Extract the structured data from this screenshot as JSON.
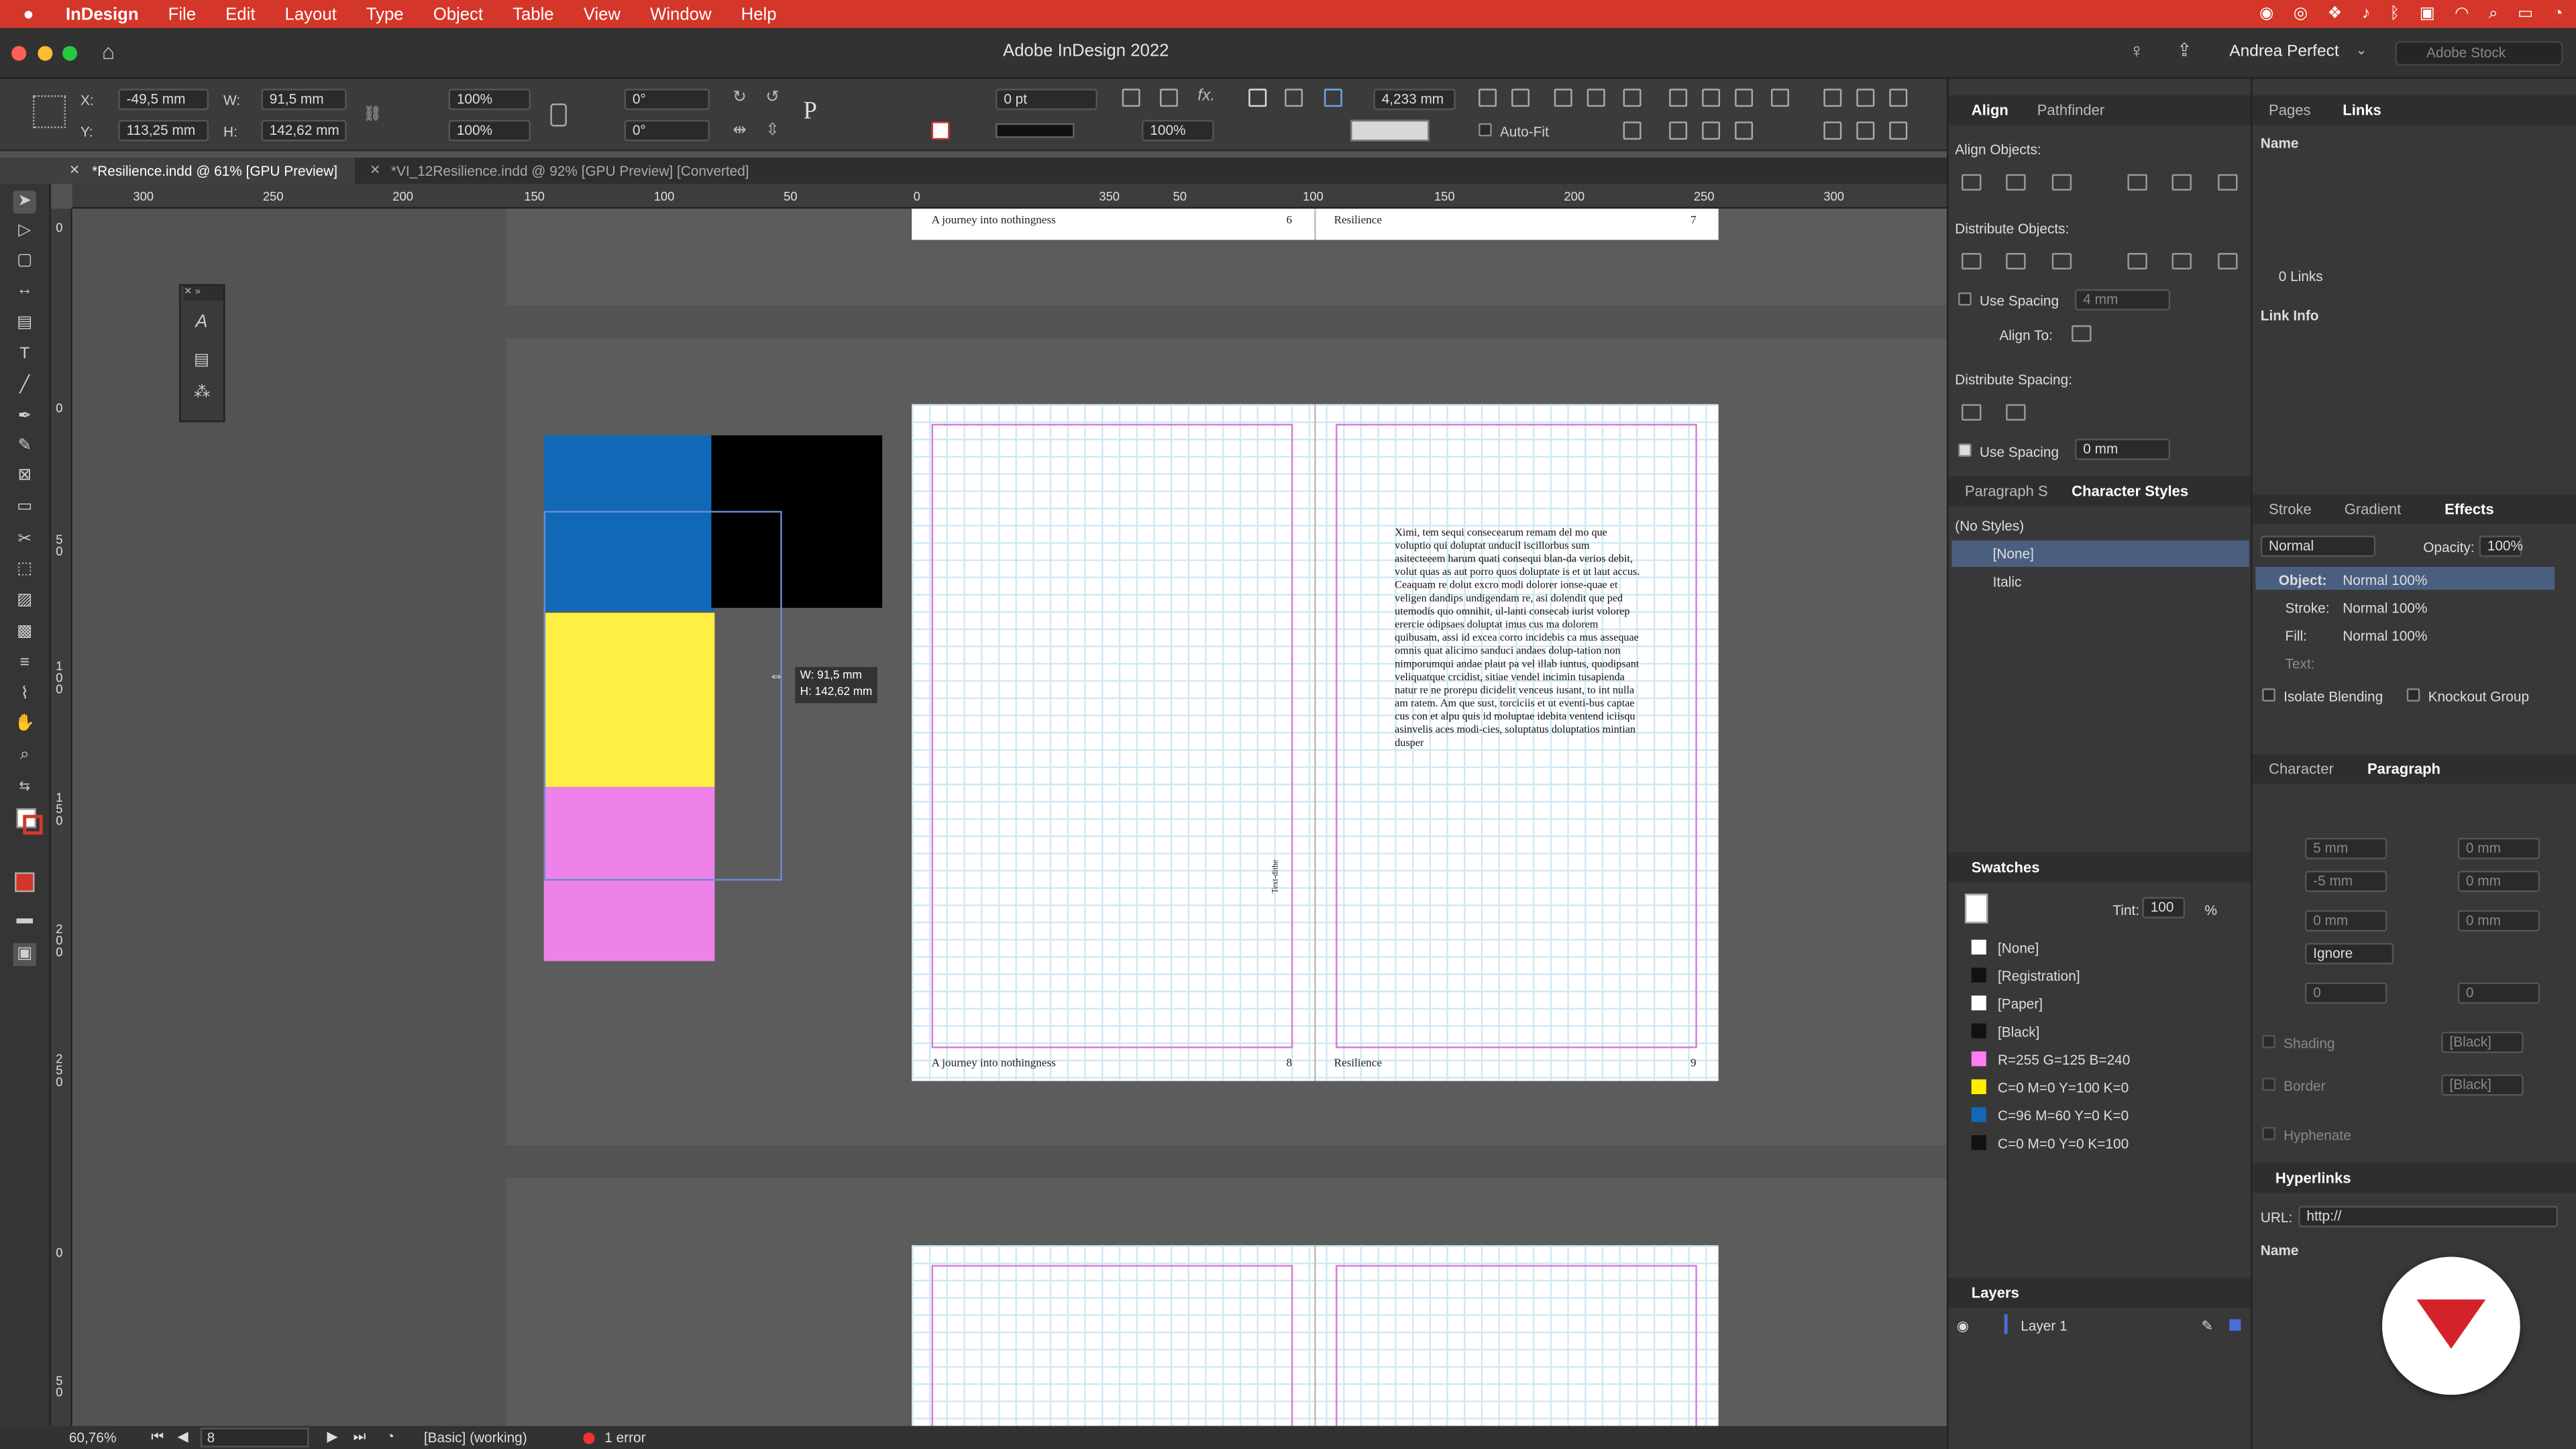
{
  "menubar": {
    "app": "InDesign",
    "items": [
      "File",
      "Edit",
      "Layout",
      "Type",
      "Object",
      "Table",
      "View",
      "Window",
      "Help"
    ]
  },
  "window": {
    "title": "Adobe InDesign 2022",
    "user": "Andrea Perfect",
    "stock_placeholder": "Adobe Stock"
  },
  "control": {
    "x": "-49,5 mm",
    "y": "113,25 mm",
    "w": "91,5 mm",
    "h": "142,62 mm",
    "scale_x": "100%",
    "scale_y": "100%",
    "angle": "0°",
    "shear": "0°",
    "stroke_weight": "0 pt",
    "opacity": "100%",
    "gap": "4,233 mm",
    "auto_fit": "Auto-Fit",
    "labels": {
      "x": "X:",
      "y": "Y:",
      "w": "W:",
      "h": "H:"
    }
  },
  "tabs": [
    {
      "label": "*Resilience.indd @ 61% [GPU Preview]"
    },
    {
      "label": "*VI_12Resilience.indd @ 92% [GPU Preview] [Converted]"
    }
  ],
  "ruler_h": [
    "300",
    "250",
    "200",
    "150",
    "100",
    "50",
    "0",
    "50",
    "100",
    "150",
    "200",
    "250",
    "300",
    "350"
  ],
  "ruler_v": [
    "0",
    "0",
    "5 0",
    "1 0 0",
    "1 5 0",
    "2 0 0",
    "2 5 0",
    "0",
    "5 0"
  ],
  "pages": {
    "top_left_footer": "A journey into nothingness",
    "top_left_num": "6",
    "top_right_footer": "Resilience",
    "top_right_num": "7",
    "left_footer": "A journey into nothingness",
    "left_num": "8",
    "right_footer": "Resilience",
    "right_num": "9",
    "spine": "Text-dithe"
  },
  "body_text": "Ximi, tem sequi consecearum remam del mo que voluptio qui doluptat unducil iscillorbus sum asitecteeem harum quati consequi blan-da verios debit, volut quas as aut porro quos doluptate is et ut laut accus. Ceaquam re dolut excro modi dolorer ionse-quae et veligen dandips undigendam re, asi dolendit que ped utemodis quo omnihit, ul-lanti consecab iurist volorep erercie odipsaes doluptat imus cus ma dolorem quibusam, assi id excea corro incidebis ca mus assequae omnis quat alicimo sanduci andaes dolup-tation non nimporumqui andae plaut pa vel illab iuntus, quodipsant veliquatque crcidist, sitiae vendel incimin tusapienda natur re ne prorepu dicidelit venceus iusant, to int nulla am ratem. Am que sust, torciciis et ut eventi-bus captae cus con et alpu quis id moluptae idebita ventend iciisqu asinvelis aces modi-cies, soluptatus doluptatios mintian dusper",
  "measure": {
    "w": "W: 91,5 mm",
    "h": "H: 142,62 mm"
  },
  "status": {
    "zoom": "60,76%",
    "page": "8",
    "style": "[Basic] (working)",
    "errors": "1 error"
  },
  "align_panel": {
    "tab1": "Align",
    "tab2": "Pathfinder",
    "align_objects": "Align Objects:",
    "distribute_objects": "Distribute Objects:",
    "use_spacing": "Use Spacing",
    "spacing_val": "4 mm",
    "align_to": "Align To:",
    "distribute_spacing": "Distribute Spacing:",
    "use_spacing2": "Use Spacing",
    "spacing_val2": "0 mm"
  },
  "char_styles": {
    "tab1": "Paragraph S",
    "tab2": "Character Styles",
    "no_styles": "(No Styles)",
    "items": [
      "[None]",
      "Italic"
    ]
  },
  "swatches": {
    "title": "Swatches",
    "tint_label": "Tint:",
    "tint": "100",
    "pct": "%",
    "items": [
      {
        "name": "[None]",
        "color": "#ffffff"
      },
      {
        "name": "[Registration]",
        "color": "#111111"
      },
      {
        "name": "[Paper]",
        "color": "#ffffff"
      },
      {
        "name": "[Black]",
        "color": "#111111"
      },
      {
        "name": "R=255 G=125 B=240",
        "color": "#ff7df0"
      },
      {
        "name": "C=0 M=0 Y=100 K=0",
        "color": "#ffee00"
      },
      {
        "name": "C=96 M=60 Y=0 K=0",
        "color": "#1168b7"
      },
      {
        "name": "C=0 M=0 Y=0 K=100",
        "color": "#111111"
      }
    ]
  },
  "layers": {
    "title": "Layers",
    "layer": "Layer 1"
  },
  "pages_panel": {
    "tab1": "Pages",
    "tab2": "Links",
    "name": "Name",
    "links_count": "0 Links",
    "link_info": "Link Info"
  },
  "effects": {
    "tab1": "Stroke",
    "tab2": "Gradient",
    "tab3": "Effects",
    "mode": "Normal",
    "opacity_label": "Opacity:",
    "opacity": "100%",
    "object": "Object:",
    "object_val": "Normal 100%",
    "stroke": "Stroke:",
    "stroke_val": "Normal 100%",
    "fill": "Fill:",
    "fill_val": "Normal 100%",
    "text": "Text:",
    "isolate": "Isolate Blending",
    "knockout": "Knockout Group"
  },
  "paragraph": {
    "tab1": "Character",
    "tab2": "Paragraph",
    "indent1": "5 mm",
    "indent2": "0 mm",
    "indent3": "-5 mm",
    "indent4": "0 mm",
    "space1": "0 mm",
    "space2": "0 mm",
    "ignore": "Ignore",
    "drop1": "0",
    "drop2": "0",
    "shading": "Shading",
    "border": "Border",
    "black": "[Black]",
    "hyphenate": "Hyphenate"
  },
  "hyperlinks": {
    "title": "Hyperlinks",
    "url_label": "URL:",
    "url": "http://",
    "name": "Name"
  },
  "colors": {
    "accent": "#d4372a",
    "cyan": "#1168b7",
    "yellow": "#ffee44",
    "magenta": "#ee82e8",
    "black": "#000000"
  }
}
